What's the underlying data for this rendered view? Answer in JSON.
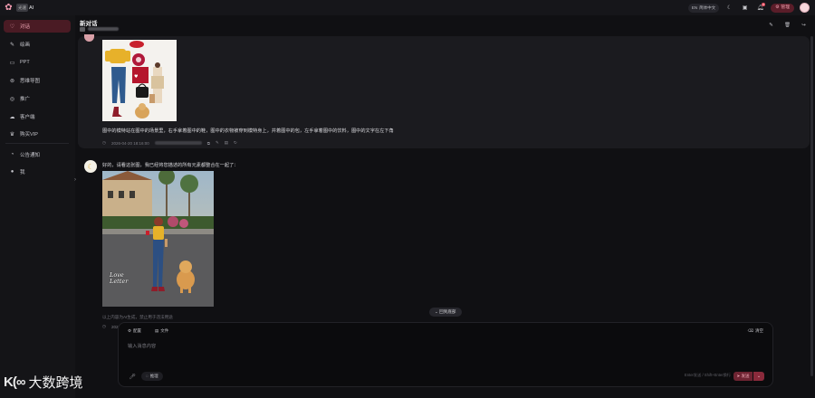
{
  "app": {
    "brand_badge": "光速",
    "brand_name": "AI"
  },
  "topbar": {
    "lang_label": "简体中文",
    "lang_prefix": "EN",
    "notification_count": "6",
    "admin_label": "管理"
  },
  "sidebar": {
    "items": [
      {
        "label": "对话",
        "icon": "chat-heart-icon"
      },
      {
        "label": "绘画",
        "icon": "brush-icon"
      },
      {
        "label": "PPT",
        "icon": "ppt-icon"
      },
      {
        "label": "思维导图",
        "icon": "mindmap-icon"
      },
      {
        "label": "推广",
        "icon": "promote-icon"
      },
      {
        "label": "客户端",
        "icon": "cloud-icon"
      },
      {
        "label": "购买VIP",
        "icon": "crown-icon"
      },
      {
        "label": "公告通知",
        "icon": "bell-icon"
      },
      {
        "label": "我",
        "icon": "user-icon"
      }
    ]
  },
  "conversation": {
    "title": "新对话"
  },
  "messages": {
    "user_text": "图中的模特站在图中的场景里，右手拿着图中的鞋，图中的衣物被穿到模特身上，并着图中的包，左手拿着图中的饮料，图中的文字在左下角",
    "user_time": "2026-04-20 18:16:00",
    "ai_text": "好的，请看这张图，我已经将您描述的所有元素都整合在一起了：",
    "ai_image_script": "Love Letter",
    "ai_note": "以上内容为AI生成，禁止用于违法用途",
    "ai_time_prefix": "2026"
  },
  "back_to_bottom": "回到底部",
  "composer": {
    "chip_model": "配置",
    "chip_file": "文件",
    "chip_right": "清空",
    "placeholder": "输入消息内容",
    "think_label": "推理",
    "hint": "Enter发送 / Shift+Enter换行",
    "send_label": "发送"
  },
  "watermark": {
    "text": "大数跨境"
  },
  "colors": {
    "accent": "#e54b5e",
    "active_bg": "#4a1b24",
    "background": "#101013"
  }
}
